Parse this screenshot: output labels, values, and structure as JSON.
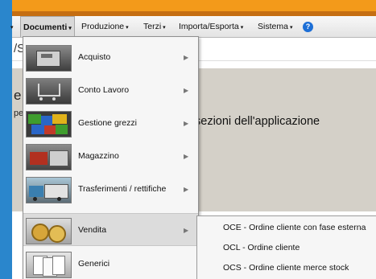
{
  "menubar": {
    "items": [
      {
        "label": "Documenti"
      },
      {
        "label": "Produzione"
      },
      {
        "label": "Terzi"
      },
      {
        "label": "Importa/Esporta"
      },
      {
        "label": "Sistema"
      }
    ],
    "help_icon": "question-circle-icon",
    "help_glyph": "?"
  },
  "subbar": {
    "text": "/S"
  },
  "content": {
    "big_letter": "e",
    "small_text": "pe",
    "text": "sezioni dell'applicazione"
  },
  "dropdown": {
    "items": [
      {
        "label": "Acquisto",
        "icon": "cash-register-icon"
      },
      {
        "label": "Conto Lavoro",
        "icon": "shopping-cart-icon"
      },
      {
        "label": "Gestione grezzi",
        "icon": "puzzle-icon"
      },
      {
        "label": "Magazzino",
        "icon": "warehouse-icon"
      },
      {
        "label": "Trasferimenti / rettifiche",
        "icon": "trucks-icon"
      },
      {
        "label": "Vendita",
        "icon": "coins-icon"
      },
      {
        "label": "Generici",
        "icon": "documents-icon"
      }
    ]
  },
  "submenu": {
    "items": [
      {
        "label": "OCE - Ordine cliente con fase esterna"
      },
      {
        "label": "OCL - Ordine cliente"
      },
      {
        "label": "OCS - Ordine cliente merce stock"
      }
    ]
  },
  "colors": {
    "accent_orange": "#f39a1a",
    "frame_blue": "#2a86cc",
    "content_bg": "#d4d0c8"
  }
}
